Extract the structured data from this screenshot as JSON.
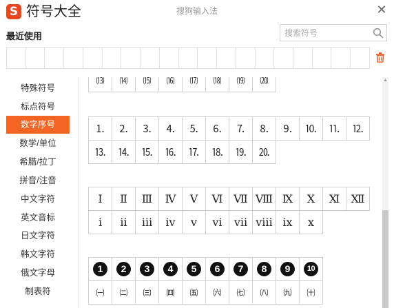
{
  "app": {
    "logo_glyph": "S",
    "title": "符号大全",
    "ime_name": "搜狗输入法",
    "close_glyph": "✕",
    "accent_color": "#f26522"
  },
  "recent": {
    "label": "最近使用",
    "cells": [
      "",
      "",
      "",
      "",
      "",
      "",
      "",
      "",
      "",
      "",
      "",
      "",
      "",
      "",
      "",
      "",
      "",
      "",
      ""
    ]
  },
  "search": {
    "placeholder": "搜索符号",
    "value": ""
  },
  "sidebar": {
    "items": [
      {
        "label": "特殊符号",
        "active": false
      },
      {
        "label": "标点符号",
        "active": false
      },
      {
        "label": "数字序号",
        "active": true
      },
      {
        "label": "数学/单位",
        "active": false
      },
      {
        "label": "希腊/拉丁",
        "active": false
      },
      {
        "label": "拼音/注音",
        "active": false
      },
      {
        "label": "中文字符",
        "active": false
      },
      {
        "label": "英文音标",
        "active": false
      },
      {
        "label": "日文字符",
        "active": false
      },
      {
        "label": "韩文字符",
        "active": false
      },
      {
        "label": "俄文字母",
        "active": false
      },
      {
        "label": "制表符",
        "active": false
      }
    ]
  },
  "symbols": {
    "paren_numbers_row": [
      "⒀",
      "⒁",
      "⒂",
      "⒃",
      "⒄",
      "⒅",
      "⒆",
      "⒇"
    ],
    "dot_numbers": [
      [
        "⒈",
        "⒉",
        "⒊",
        "⒋",
        "⒌",
        "⒍",
        "⒎",
        "⒏",
        "⒐",
        "⒑",
        "⒒",
        "⒓"
      ],
      [
        "⒔",
        "⒕",
        "⒖",
        "⒗",
        "⒘",
        "⒙",
        "⒚",
        "⒛"
      ]
    ],
    "roman_numerals": [
      [
        "Ⅰ",
        "Ⅱ",
        "Ⅲ",
        "Ⅳ",
        "Ⅴ",
        "Ⅵ",
        "Ⅶ",
        "Ⅷ",
        "Ⅸ",
        "Ⅹ",
        "Ⅺ",
        "Ⅻ"
      ],
      [
        "ⅰ",
        "ⅱ",
        "ⅲ",
        "ⅳ",
        "ⅴ",
        "ⅵ",
        "ⅶ",
        "ⅷ",
        "ⅸ",
        "ⅹ"
      ]
    ],
    "circled_numbers": [
      "1",
      "2",
      "3",
      "4",
      "5",
      "6",
      "7",
      "8",
      "9",
      "10"
    ],
    "paren_cjk_numbers": [
      "㈠",
      "㈡",
      "㈢",
      "㈣",
      "㈤",
      "㈥",
      "㈦",
      "㈧",
      "㈨",
      "㈩"
    ]
  }
}
